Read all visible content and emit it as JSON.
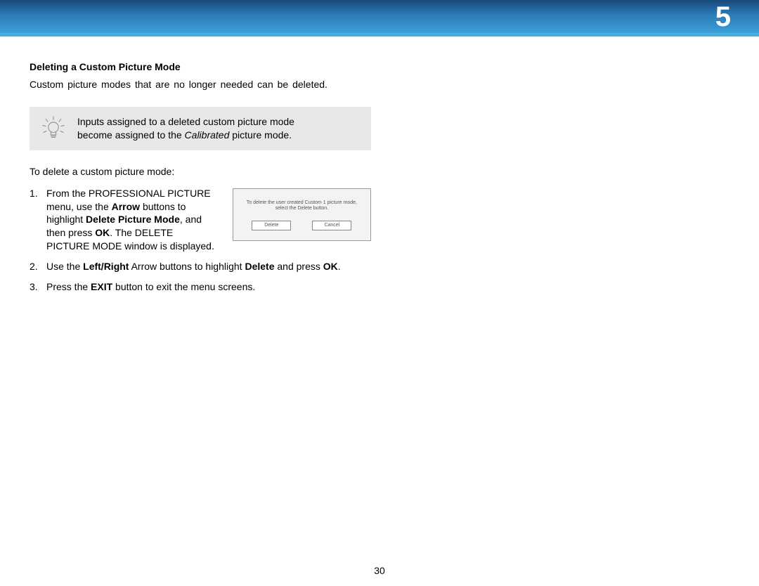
{
  "chapter_number": "5",
  "page_number": "30",
  "section_title": "Deleting a Custom Picture Mode",
  "intro": "Custom picture modes that are no longer needed can be deleted.",
  "tip_line1": "Inputs assigned to a deleted custom picture mode",
  "tip_line2_prefix": "become assigned to the ",
  "tip_line2_italic": "Calibrated",
  "tip_line2_suffix": " picture mode.",
  "lead": "To delete a custom picture mode:",
  "steps": {
    "s1": {
      "p1": "From the PROFESSIONAL PICTURE menu, use the ",
      "b1": "Arrow",
      "p2": " buttons to highlight ",
      "b2": "Delete Picture Mode",
      "p3": ", and then press ",
      "b3": "OK",
      "p4": ". The DELETE PICTURE MODE window is displayed."
    },
    "s2": {
      "p1": "Use the ",
      "b1": "Left/Right",
      "p2": " Arrow buttons to highlight ",
      "b2": "Delete",
      "p3": " and press ",
      "b3": "OK",
      "p4": "."
    },
    "s3": {
      "p1": "Press the ",
      "b1": "EXIT",
      "p2": " button to exit the menu screens."
    }
  },
  "dialog": {
    "message": "To delete the user created Custom 1 picture mode, select the Delete button.",
    "btn_delete": "Delete",
    "btn_cancel": "Cancel"
  }
}
